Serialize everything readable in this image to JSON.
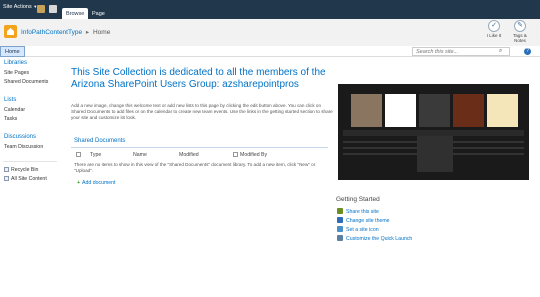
{
  "ribbon": {
    "site_actions_label": "Site Actions",
    "tabs": [
      {
        "label": "Browse",
        "active": true
      },
      {
        "label": "Page",
        "active": false
      }
    ]
  },
  "title_area": {
    "site_name": "InfoPathContentType",
    "separator": "▸",
    "current_page": "Home",
    "social": [
      {
        "label": "I Like It",
        "icon": "thumb-up-icon"
      },
      {
        "label": "Tags & Notes",
        "icon": "tag-icon"
      }
    ]
  },
  "top_nav": {
    "home_label": "Home",
    "search_placeholder": "Search this site...",
    "search_icon_glyph": "⌕",
    "help_glyph": "?"
  },
  "quick_launch": {
    "libraries_heading": "Libraries",
    "libraries": [
      "Site Pages",
      "Shared Documents"
    ],
    "lists_heading": "Lists",
    "lists": [
      "Calendar",
      "Tasks"
    ],
    "discussions_heading": "Discussions",
    "discussions": [
      "Team Discussion"
    ],
    "utilities": [
      {
        "label": "Recycle Bin",
        "icon": "recycle-bin-icon"
      },
      {
        "label": "All Site Content",
        "icon": "site-content-icon"
      }
    ]
  },
  "main": {
    "welcome_title": "This Site Collection is dedicated to all the members of the Arizona SharePoint Users Group: azsharepointpros",
    "description": "Add a new image, change this welcome text or add new lists to this page by clicking the edit button above. You can click on Shared Documents to add files or on the calendar to create new team events. Use the links in the getting started section to share your site and customize its look.",
    "library": {
      "title": "Shared Documents",
      "columns": [
        "Type",
        "Name",
        "Modified",
        "Modified By"
      ],
      "empty_message": "There are no items to show in this view of the \"Shared Documents\" document library. To add a new item, click \"New\" or \"Upload\".",
      "add_label": "Add document",
      "add_glyph": "+"
    }
  },
  "getting_started": {
    "title": "Getting Started",
    "items": [
      {
        "label": "Share this site",
        "icon": "share-icon",
        "color": "#6b8e23"
      },
      {
        "label": "Change site theme",
        "icon": "theme-icon",
        "color": "#2e6bb8"
      },
      {
        "label": "Set a site icon",
        "icon": "picture-icon",
        "color": "#4a90c8"
      },
      {
        "label": "Customize the Quick Launch",
        "icon": "quick-launch-icon",
        "color": "#5b7fa5"
      }
    ]
  },
  "colors": {
    "ribbon_bg": "#21374c",
    "link": "#0072c6",
    "logo": "#f3a31c"
  }
}
